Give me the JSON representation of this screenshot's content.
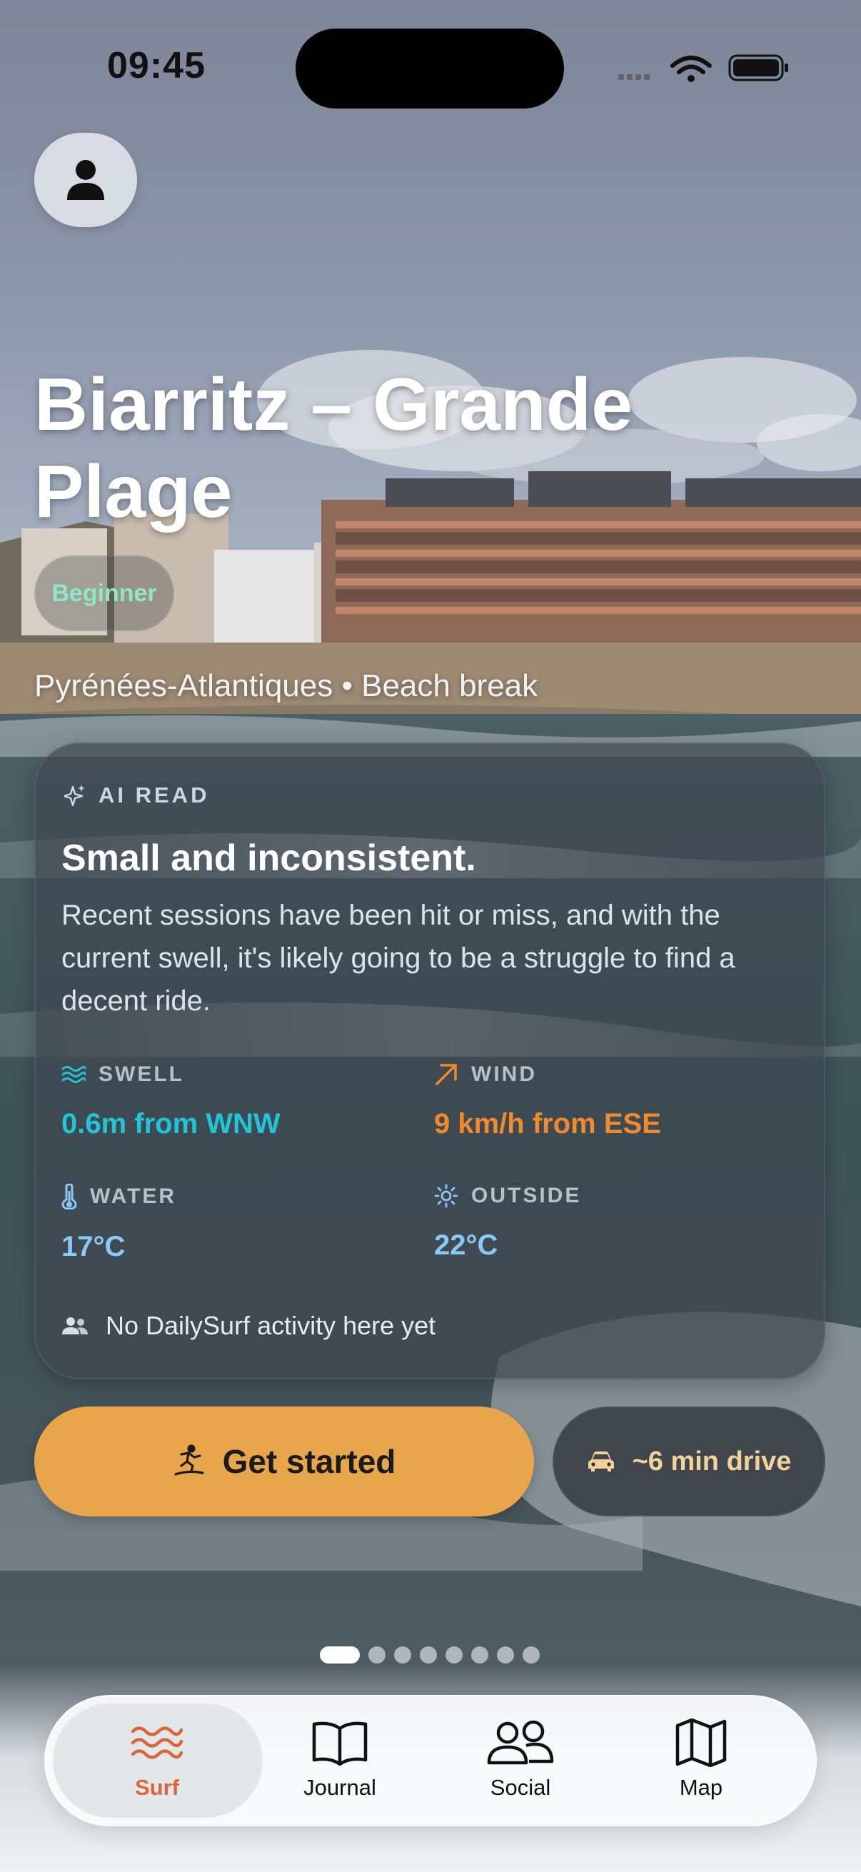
{
  "status_bar": {
    "time": "09:45"
  },
  "spot": {
    "title": "Biarritz – Grande Plage",
    "level": "Beginner",
    "meta": "Pyrénées-Atlantiques • Beach break"
  },
  "ai_read": {
    "label": "AI READ",
    "headline": "Small and inconsistent.",
    "body": "Recent sessions have been hit or miss, and with the current swell, it's likely going to be a struggle to find a decent ride.",
    "stats": {
      "swell": {
        "label": "SWELL",
        "value": "0.6m from WNW",
        "color": "#22c4d8"
      },
      "wind": {
        "label": "WIND",
        "value": "9 km/h from ESE",
        "color": "#f08a2e"
      },
      "water": {
        "label": "WATER",
        "value": "17°C",
        "color": "#8cc8f5"
      },
      "outside": {
        "label": "OUTSIDE",
        "value": "22°C",
        "color": "#8cc8f5"
      }
    },
    "activity": "No DailySurf activity here yet"
  },
  "actions": {
    "get_started": "Get started",
    "drive": "~6 min drive"
  },
  "pager": {
    "count": 8,
    "active": 1
  },
  "tabs": [
    {
      "label": "Surf",
      "icon": "waves-icon",
      "active": true
    },
    {
      "label": "Journal",
      "icon": "book-icon",
      "active": false
    },
    {
      "label": "Social",
      "icon": "people-icon",
      "active": false
    },
    {
      "label": "Map",
      "icon": "map-icon",
      "active": false
    }
  ],
  "colors": {
    "accent_orange": "#e8a54c",
    "tab_active": "#d9663a",
    "level_green": "#8fe7c6"
  }
}
